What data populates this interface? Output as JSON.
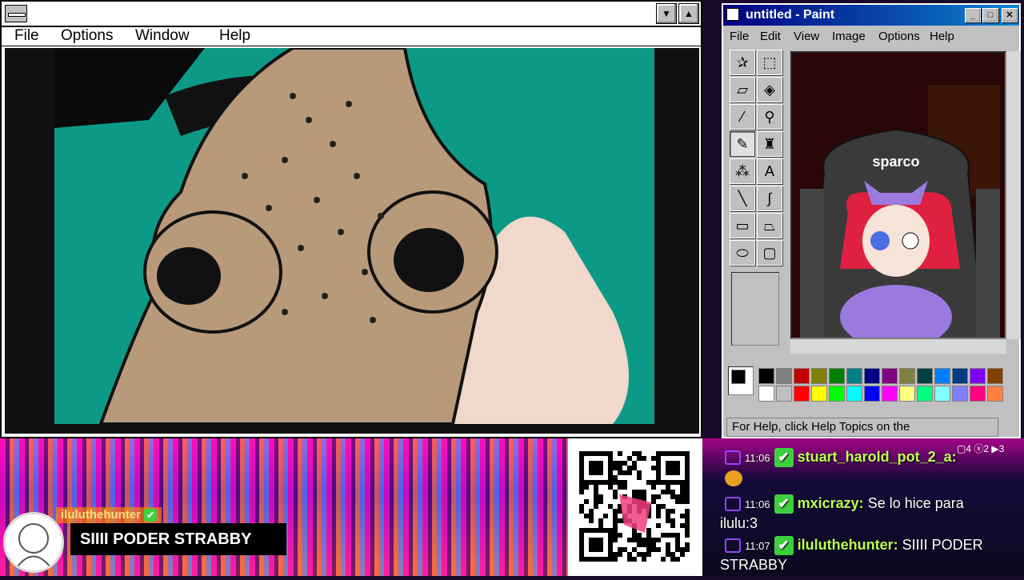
{
  "left_window": {
    "menu": [
      "File",
      "Options",
      "Window",
      "Help"
    ]
  },
  "paint": {
    "title": "untitled - Paint",
    "menu": [
      "File",
      "Edit",
      "View",
      "Image",
      "Options",
      "Help"
    ],
    "status": "For Help, click Help Topics on the",
    "chair_logo": "sparco",
    "palette_top": [
      "#000000",
      "#808080",
      "#c00000",
      "#808000",
      "#008000",
      "#008080",
      "#000080",
      "#800080",
      "#808040",
      "#004040",
      "#0080ff",
      "#004080",
      "#8000ff",
      "#804000"
    ],
    "palette_bottom": [
      "#ffffff",
      "#c0c0c0",
      "#ff0000",
      "#ffff00",
      "#00ff00",
      "#00ffff",
      "#0000ff",
      "#ff00ff",
      "#ffff80",
      "#00ff80",
      "#80ffff",
      "#8080ff",
      "#ff0080",
      "#ff8040"
    ]
  },
  "alert": {
    "username": "iluluthehunter",
    "message": "SIIII PODER STRABBY"
  },
  "chat": {
    "messages": [
      {
        "time": "11:06",
        "user": "stuart_harold_pot_2_a:",
        "text": ""
      },
      {
        "time": "11:06",
        "user": "mxicrazy:",
        "text": "Se lo hice para",
        "cont": "ilulu:3"
      },
      {
        "time": "11:07",
        "user": "iluluthehunter:",
        "text": "SIIII PODER",
        "cont": "STRABBY"
      }
    ]
  }
}
